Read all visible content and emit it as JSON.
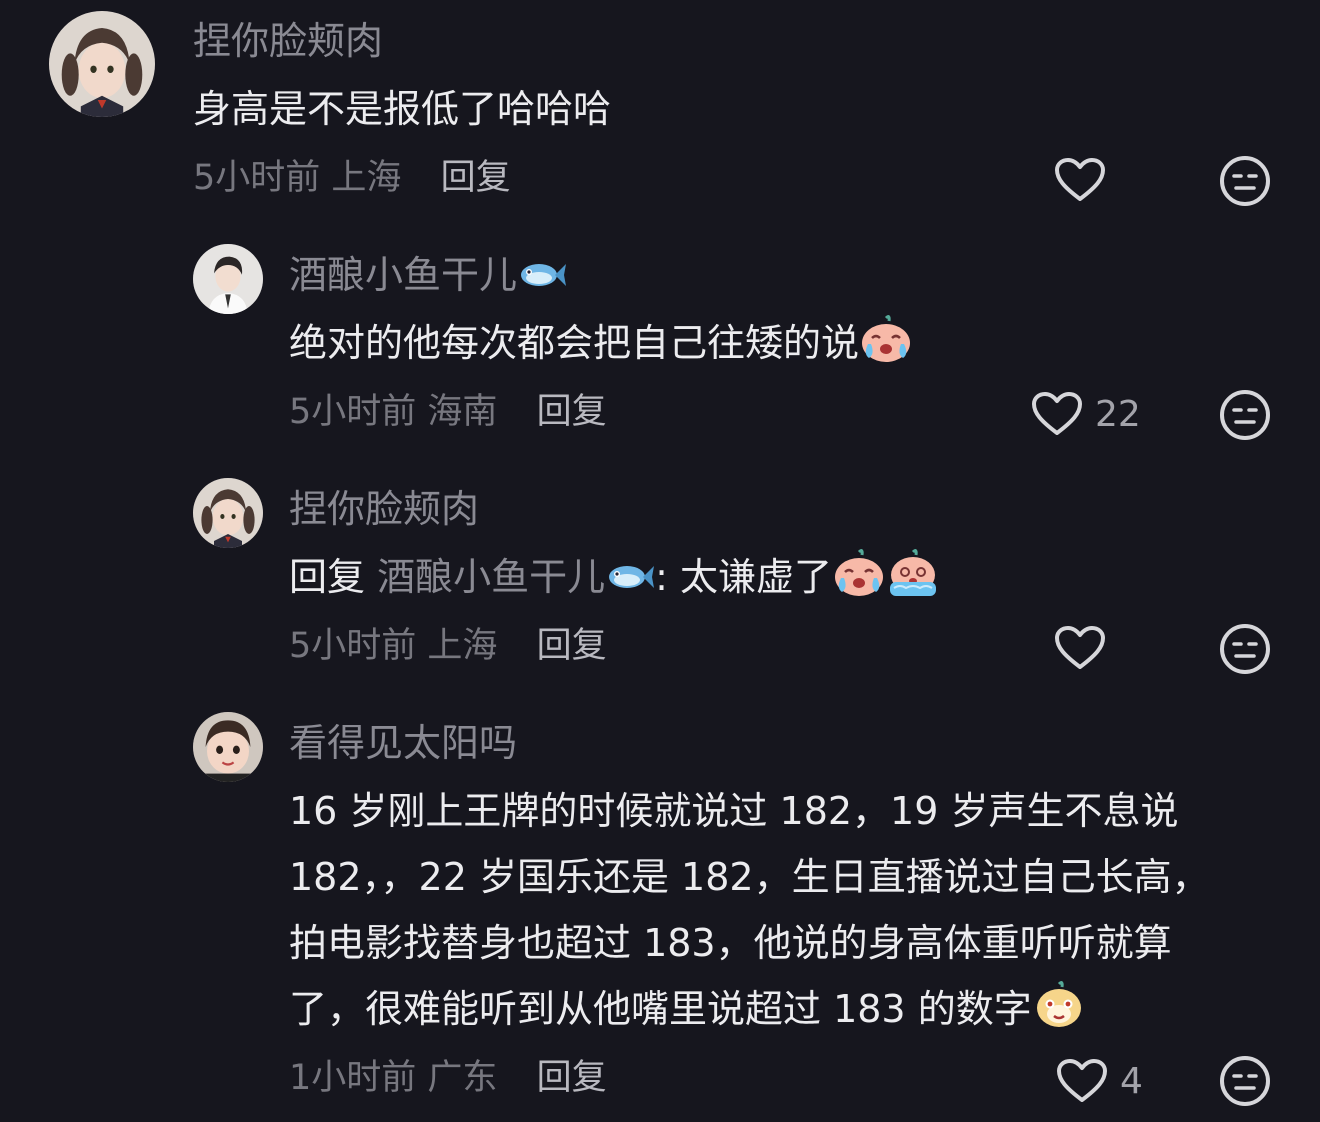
{
  "comments": [
    {
      "username": "捏你脸颊肉",
      "text": "身高是不是报低了哈哈哈",
      "time": "5小时前",
      "location": "上海",
      "reply_label": "回复",
      "like_count": "",
      "avatar_icon": "girl-pigtails-avatar"
    },
    {
      "username": "酒酿小鱼干儿",
      "username_emoji": "fish-emoji",
      "text": "绝对的他每次都会把自己往矮的说",
      "text_emoji": "crying-emoji",
      "time": "5小时前",
      "location": "海南",
      "reply_label": "回复",
      "like_count": "22",
      "avatar_icon": "boy-avatar"
    },
    {
      "username": "捏你脸颊肉",
      "reply_prefix": "回复",
      "reply_to": "酒酿小鱼干儿",
      "reply_to_emoji": "fish-emoji",
      "text": ": 太谦虚了",
      "text_emojis": [
        "crying-emoji",
        "sobbing-emoji"
      ],
      "time": "5小时前",
      "location": "上海",
      "reply_label": "回复",
      "like_count": "",
      "avatar_icon": "girl-pigtails-avatar"
    },
    {
      "username": "看得见太阳吗",
      "text_lines": [
        "16 岁刚上王牌的时候就说过 182，19 岁声生不息说",
        "182，，22 岁国乐还是 182，生日直播说过自己长高，",
        "拍电影找替身也超过 183，他说的身高体重听听就算",
        "了，很难能听到从他嘴里说超过 183 的数字"
      ],
      "text_emoji": "smug-emoji",
      "time": "1小时前",
      "location": "广东",
      "reply_label": "回复",
      "like_count": "4",
      "avatar_icon": "child-avatar"
    }
  ],
  "colors": {
    "background": "#16161e",
    "username": "#8a8a93",
    "text": "#ececef",
    "meta": "#77777f",
    "icon": "#d6d6da"
  }
}
